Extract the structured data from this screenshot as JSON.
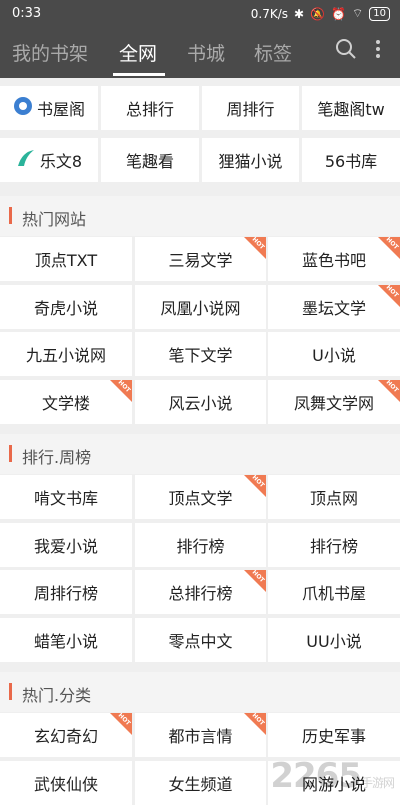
{
  "status": {
    "time": "0:33",
    "speed": "0.7K/s",
    "battery": "10"
  },
  "nav": {
    "tabs": [
      "我的书架",
      "全网",
      "书城",
      "标签"
    ],
    "active": 1
  },
  "top_links": [
    [
      "书屋阁",
      "总排行",
      "周排行",
      "笔趣阁tw"
    ],
    [
      "乐文8",
      "笔趣看",
      "狸猫小说",
      "56书库"
    ]
  ],
  "sections": [
    {
      "title": "热门网站",
      "items": [
        {
          "label": "顶点TXT",
          "hot": false
        },
        {
          "label": "三易文学",
          "hot": true
        },
        {
          "label": "蓝色书吧",
          "hot": true
        },
        {
          "label": "奇虎小说",
          "hot": false
        },
        {
          "label": "凤凰小说网",
          "hot": false
        },
        {
          "label": "墨坛文学",
          "hot": true
        },
        {
          "label": "九五小说网",
          "hot": false
        },
        {
          "label": "笔下文学",
          "hot": false
        },
        {
          "label": "U小说",
          "hot": false
        },
        {
          "label": "文学楼",
          "hot": true
        },
        {
          "label": "风云小说",
          "hot": false
        },
        {
          "label": "凤舞文学网",
          "hot": true
        }
      ]
    },
    {
      "title": "排行.周榜",
      "items": [
        {
          "label": "啃文书库",
          "hot": false
        },
        {
          "label": "顶点文学",
          "hot": true
        },
        {
          "label": "顶点网",
          "hot": false
        },
        {
          "label": "我爱小说",
          "hot": false
        },
        {
          "label": "排行榜",
          "hot": false
        },
        {
          "label": "排行榜",
          "hot": false
        },
        {
          "label": "周排行榜",
          "hot": false
        },
        {
          "label": "总排行榜",
          "hot": true
        },
        {
          "label": "爪机书屋",
          "hot": false
        },
        {
          "label": "蜡笔小说",
          "hot": false
        },
        {
          "label": "零点中文",
          "hot": false
        },
        {
          "label": "UU小说",
          "hot": false
        }
      ]
    },
    {
      "title": "热门.分类",
      "items": [
        {
          "label": "玄幻奇幻",
          "hot": true
        },
        {
          "label": "都市言情",
          "hot": true
        },
        {
          "label": "历史军事",
          "hot": false
        },
        {
          "label": "武侠仙侠",
          "hot": false
        },
        {
          "label": "女生频道",
          "hot": false
        },
        {
          "label": "网游小说",
          "hot": false
        }
      ]
    }
  ],
  "hot_badge": "HOT",
  "watermark": {
    "main": "2265",
    "sub": "手游网"
  },
  "colors": {
    "header": "#4a4a4a",
    "accent": "#e9694a",
    "hot": "#f07a52"
  }
}
